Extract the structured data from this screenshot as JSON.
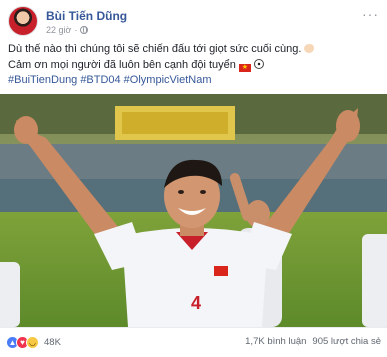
{
  "post": {
    "author": "Bùi Tiến Dũng",
    "time": "22 giờ",
    "more_label": "···",
    "lines": [
      "Dù thế nào thì chúng tôi sẽ chiến đấu tới giọt sức cuối cùng.",
      "Cảm ơn mọi người đã luôn bên cạnh đội tuyển"
    ],
    "hashtags": [
      "#BuiTienDung",
      "#BTD04",
      "#OlympicVietNam"
    ],
    "emojis": [
      "flexed-biceps",
      "vietnam-flag",
      "soccer-ball"
    ],
    "photo": {
      "jersey_number": "4"
    }
  },
  "footer": {
    "reactions": [
      "like",
      "love",
      "haha"
    ],
    "reaction_count": "48K",
    "comments": "1,7K bình luận",
    "shares": "905 lượt chia sẻ"
  },
  "colors": {
    "link": "#365899",
    "text": "#1d2129",
    "meta": "#90949c",
    "like": "#4a7cf7",
    "love": "#f0334f",
    "haha": "#f7c843"
  }
}
